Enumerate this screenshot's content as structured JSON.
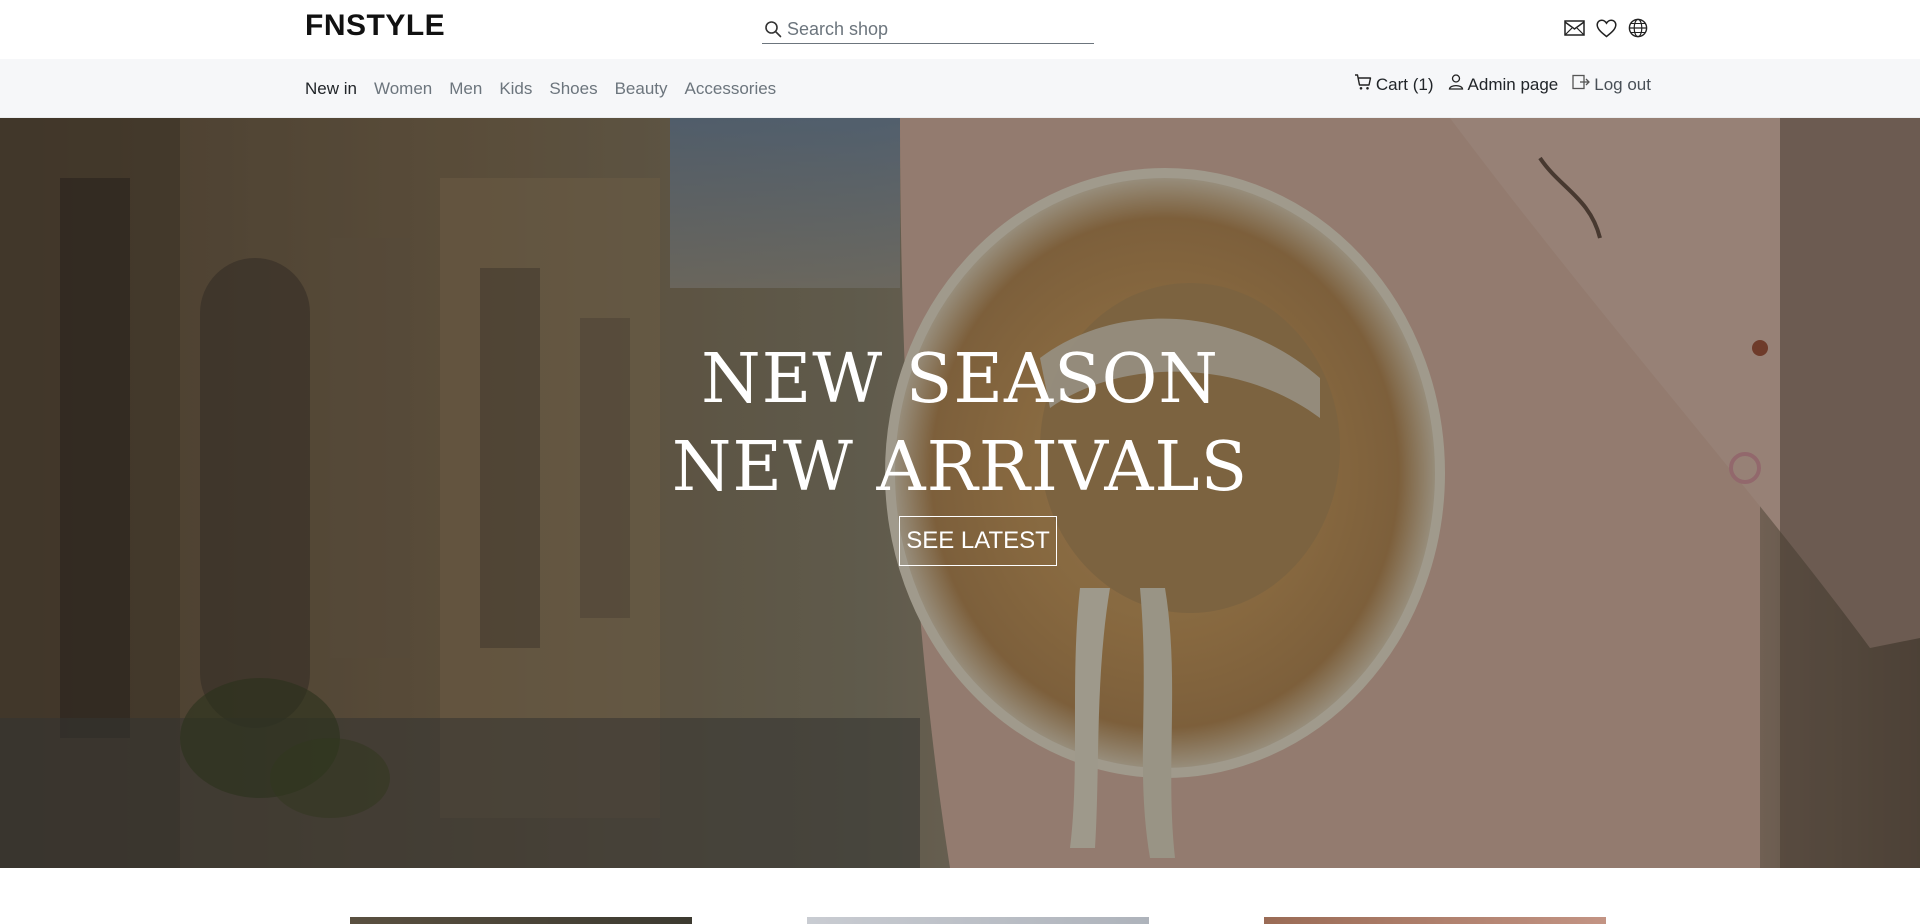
{
  "header": {
    "brand": "FNSTYLE",
    "search_placeholder": "Search shop",
    "icons": [
      "mail-icon",
      "heart-icon",
      "globe-icon"
    ]
  },
  "nav": {
    "items": [
      {
        "label": "New in",
        "active": true
      },
      {
        "label": "Women"
      },
      {
        "label": "Men"
      },
      {
        "label": "Kids"
      },
      {
        "label": "Shoes"
      },
      {
        "label": "Beauty"
      },
      {
        "label": "Accessories"
      }
    ],
    "cart_label": "Cart (1)",
    "admin_label": "Admin page",
    "logout_label": "Log out"
  },
  "hero": {
    "line1": "NEW SEASON",
    "line2": "NEW ARRIVALS",
    "button_label": "SEE LATEST"
  },
  "colors": {
    "text": "#212529",
    "muted": "#6c757d",
    "navbar_bg": "#f6f7f9"
  }
}
